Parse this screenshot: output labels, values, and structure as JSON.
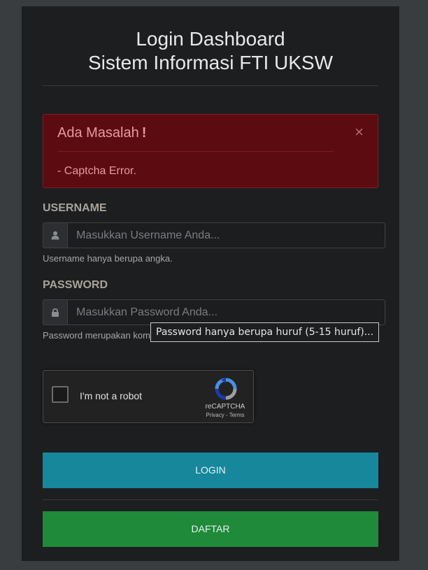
{
  "header": {
    "title_line1": "Login Dashboard",
    "title_line2": "Sistem Informasi FTI UKSW"
  },
  "alert": {
    "title": "Ada Masalah",
    "bang": "!",
    "close": "×",
    "message": "- Captcha Error."
  },
  "username": {
    "label": "USERNAME",
    "placeholder": "Masukkan Username Anda...",
    "value": "",
    "help": "Username hanya berupa angka.",
    "icon": "user-icon"
  },
  "password": {
    "label": "PASSWORD",
    "placeholder": "Masukkan Password Anda...",
    "value": "",
    "help": "Password merupakan kombinasi huruf & angka.",
    "icon": "lock-icon",
    "tooltip": "Password hanya berupa huruf (5-15 huruf)..."
  },
  "captcha": {
    "label": "I'm not a robot",
    "brand": "reCAPTCHA",
    "privacy": "Privacy",
    "separator": " - ",
    "terms": "Terms",
    "checked": false
  },
  "buttons": {
    "login": "LOGIN",
    "daftar": "DAFTAR"
  },
  "colors": {
    "page_bg": "#3a3d40",
    "panel_bg": "#1d1e20",
    "alert_bg": "#5c0b10",
    "alert_text": "#e49aa1",
    "login_button": "#17879b",
    "daftar_button": "#1f8a3a"
  }
}
